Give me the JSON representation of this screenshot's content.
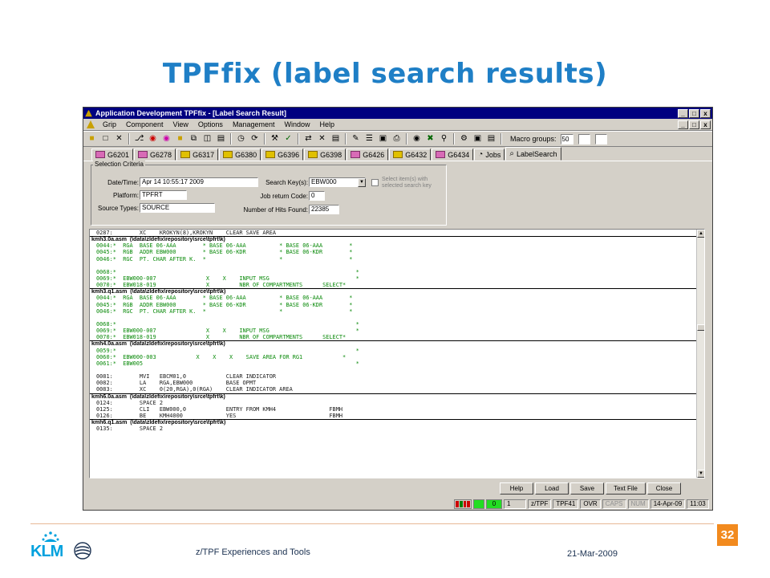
{
  "slide": {
    "title": "TPFfix (label search results)",
    "footer_center": "z/TPF Experiences and Tools",
    "footer_date": "21-Mar-2009",
    "page_number": "32",
    "logo_text": "KLM"
  },
  "window": {
    "title": "Application Development TPFfix - [Label Search Result]",
    "controls": [
      "_",
      "□",
      "x"
    ],
    "menu": [
      "Grip",
      "Component",
      "View",
      "Options",
      "Management",
      "Window",
      "Help"
    ],
    "toolbar": {
      "macro_label": "Macro groups:",
      "macro_value": "50"
    },
    "tabs": [
      {
        "label": "G6201",
        "icon": "folder-pink-icon"
      },
      {
        "label": "G6278",
        "icon": "folder-pink-icon"
      },
      {
        "label": "G6317",
        "icon": "folder-yellow-icon"
      },
      {
        "label": "G6380",
        "icon": "folder-yellow-icon"
      },
      {
        "label": "G6396",
        "icon": "folder-yellow-icon"
      },
      {
        "label": "G6398",
        "icon": "folder-yellow-icon"
      },
      {
        "label": "G6426",
        "icon": "folder-pink-icon"
      },
      {
        "label": "G6432",
        "icon": "folder-yellow-icon"
      },
      {
        "label": "G6434",
        "icon": "folder-pink-icon"
      },
      {
        "label": "Jobs",
        "icon": "jobs-icon"
      },
      {
        "label": "LabelSearch",
        "icon": "search-icon"
      }
    ],
    "selection": {
      "legend": "Selection Criteria",
      "datetime_label": "Date/Time:",
      "datetime_value": "Apr 14 10:55:17 2009",
      "platform_label": "Platform:",
      "platform_value": "TPFRT",
      "source_label": "Source Types:",
      "source_value": "SOURCE",
      "searchkey_label": "Search Key(s):",
      "searchkey_value": "EBW000",
      "jobcode_label": "Job return Code:",
      "jobcode_value": "0",
      "hits_label": "Number of Hits Found:",
      "hits_value": "22385",
      "checkbox_label_1": "Select item(s) with",
      "checkbox_label_2": "selected search key"
    },
    "results": [
      {
        "type": "code",
        "text": "0287:        XC    KROKYN(8),KROKYN    CLEAR SAVE AREA"
      },
      {
        "type": "file",
        "text": "kmh3.0a.asm  (\\data\\zldefix\\repository\\srce\\tpfrt\\k)"
      },
      {
        "type": "comment",
        "text": "0044:*  RGA  BASE 06-AAA        * BASE 06-AAA          * BASE 06-AAA        *"
      },
      {
        "type": "comment",
        "text": "0045:*  RGB  ADDR EBW000        * BASE 06-KDR          * BASE 06-KDR        *"
      },
      {
        "type": "comment",
        "text": "0046:*  RGC  PT. CHAR AFTER K.  *                      *                    *"
      },
      {
        "type": "comment",
        "text": ""
      },
      {
        "type": "comment",
        "text": "0068:*                                                                        *"
      },
      {
        "type": "comment",
        "text": "0069:*  EBW000-007               X    X    INPUT MSG                          *"
      },
      {
        "type": "comment",
        "text": "0070:*  EBW018-019               X         NBR OF COMPARTMENTS      SELECT*"
      },
      {
        "type": "file",
        "text": "kmh3.q1.asm  (\\data\\zldefix\\repository\\srce\\tpfrt\\k)"
      },
      {
        "type": "comment",
        "text": "0044:*  RGA  BASE 06-AAA        * BASE 06-AAA          * BASE 06-AAA        *"
      },
      {
        "type": "comment",
        "text": "0045:*  RGB  ADDR EBW000        * BASE 06-KDR          * BASE 06-KDR        *"
      },
      {
        "type": "comment",
        "text": "0046:*  RGC  PT. CHAR AFTER K.  *                      *                    *"
      },
      {
        "type": "comment",
        "text": ""
      },
      {
        "type": "comment",
        "text": "0068:*                                                                        *"
      },
      {
        "type": "comment",
        "text": "0069:*  EBW000-007               X    X    INPUT MSG                          *"
      },
      {
        "type": "comment",
        "text": "0070:*  EBW018-019               X         NBR OF COMPARTMENTS      SELECT*"
      },
      {
        "type": "file",
        "text": "kmh4.0a.asm  (\\data\\zldefix\\repository\\srce\\tpfrt\\k)"
      },
      {
        "type": "comment",
        "text": "0059:*                                                                        *"
      },
      {
        "type": "comment",
        "text": "0060:*  EBW000-003            X    X    X    SAVE AREA FOR RG1            *"
      },
      {
        "type": "comment",
        "text": "0061:*  EBW005                                                                *"
      },
      {
        "type": "code",
        "text": ""
      },
      {
        "type": "code",
        "text": "0081:        MVI   EBCM01,0            CLEAR INDICATOR"
      },
      {
        "type": "code",
        "text": "0082:        LA    RGA,EBW000          BASE OPMT"
      },
      {
        "type": "code",
        "text": "0083:        XC    0(20,RGA),0(RGA)    CLEAR INDICATOR AREA"
      },
      {
        "type": "file",
        "text": "kmh6.0a.asm  (\\data\\zldefix\\repository\\srce\\tpfrt\\k)"
      },
      {
        "type": "code",
        "text": "0124:        SPACE 2"
      },
      {
        "type": "code",
        "text": "0125:        CLI   EBW000,0            ENTRY FROM KMH4                FBMH"
      },
      {
        "type": "code",
        "text": "0126:        BE    KMH4000             YES                            FBMH"
      },
      {
        "type": "file",
        "text": "kmh6.q1.asm  (\\data\\zldefix\\repository\\srce\\tpfrt\\k)"
      },
      {
        "type": "code",
        "text": "0135:        SPACE 2"
      }
    ],
    "buttons": [
      "Help",
      "Load",
      "Save",
      "Text File",
      "Close"
    ],
    "status": {
      "count": "0",
      "page": "1",
      "system": "z/TPF",
      "target": "TPF41",
      "mode": "OVR",
      "caps": "CAPS",
      "num": "NUM",
      "date": "14-Apr-09",
      "time": "11:03"
    }
  },
  "colors": {
    "title": "#1f7fc6",
    "caption": "#000080",
    "comment_text": "#0a8a0a",
    "page_badge": "#f28a1e",
    "klm_blue": "#00a1de"
  }
}
